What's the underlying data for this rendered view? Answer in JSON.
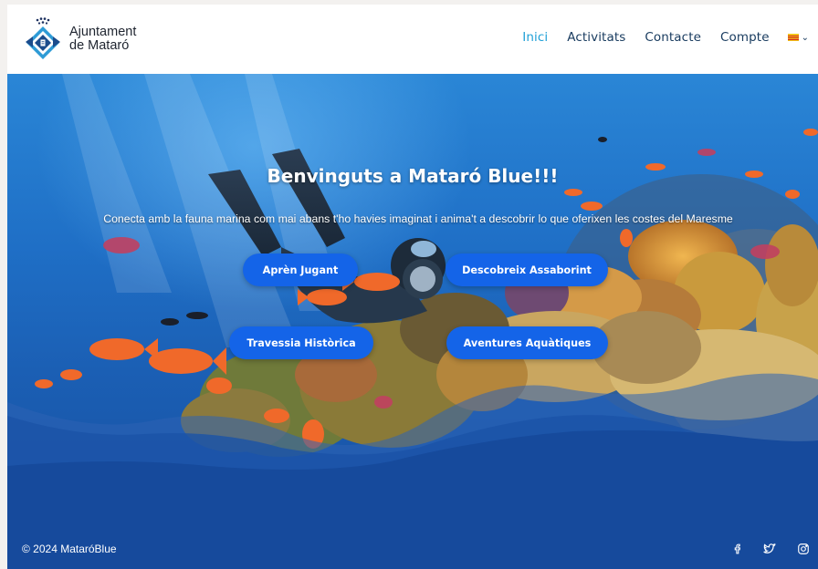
{
  "brand": {
    "line1": "Ajuntament",
    "line2": "de Mataró"
  },
  "nav": {
    "items": [
      {
        "label": "Inici",
        "active": true
      },
      {
        "label": "Activitats",
        "active": false
      },
      {
        "label": "Contacte",
        "active": false
      },
      {
        "label": "Compte",
        "active": false
      }
    ],
    "language_icon": "catalan-flag-icon"
  },
  "hero": {
    "title": "Benvinguts a Mataró Blue!!!",
    "subtitle": "Conecta amb la fauna marina com mai abans t'ho havies imaginat i anima't a descobrir lo que oferixen les costes del Maresme",
    "buttons": [
      {
        "label": "Aprèn Jugant"
      },
      {
        "label": "Descobreix Assaborint"
      },
      {
        "label": "Travessia Històrica"
      },
      {
        "label": "Aventures Aquàtiques"
      }
    ]
  },
  "footer": {
    "copyright": "© 2024 MataróBlue",
    "social": [
      "facebook-icon",
      "twitter-icon",
      "instagram-icon"
    ]
  },
  "colors": {
    "accent": "#1fa0d7",
    "nav_text": "#173a5e",
    "button": "#1464e8",
    "wave": "#164a9c"
  }
}
